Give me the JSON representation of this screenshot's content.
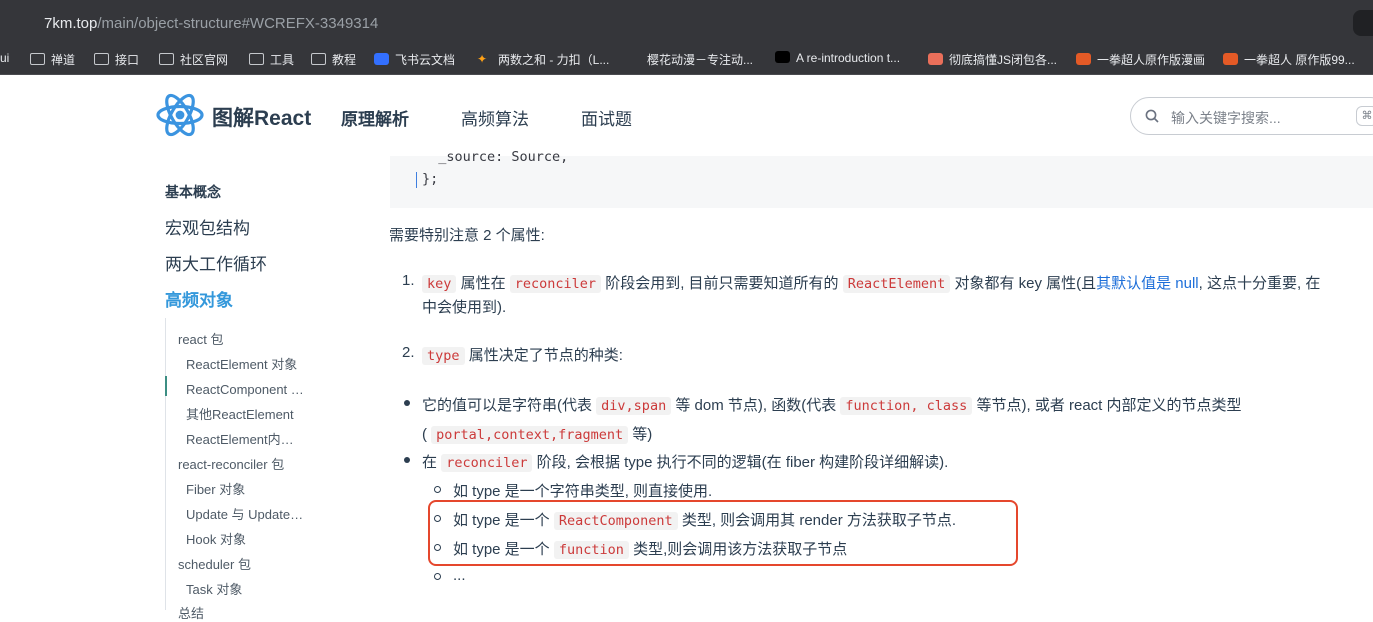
{
  "browser": {
    "url_host": "7km.top",
    "url_path": "/main/object-structure#WCREFX-3349314",
    "bookmarks": [
      {
        "label": "ui"
      },
      {
        "label": "禅道"
      },
      {
        "label": "接口"
      },
      {
        "label": "社区官网"
      },
      {
        "label": "工具"
      },
      {
        "label": "教程"
      },
      {
        "label": "飞书云文档"
      },
      {
        "label": "两数之和 - 力扣（L..."
      },
      {
        "label": "樱花动漫－专注动..."
      },
      {
        "label": "A re-introduction t..."
      },
      {
        "label": "彻底搞懂JS闭包各..."
      },
      {
        "label": "一拳超人原作版漫画"
      },
      {
        "label": "一拳超人 原作版99..."
      }
    ]
  },
  "header": {
    "title": "图解React",
    "nav": [
      "原理解析",
      "高频算法",
      "面试题"
    ],
    "search_placeholder": "输入关键字搜索...",
    "search_kbd": "⌘"
  },
  "sidebar": {
    "group_title": "基本概念",
    "items": [
      "宏观包结构",
      "两大工作循环",
      "高频对象"
    ],
    "subitems": {
      "react": "react 包",
      "re1": "ReactElement 对象",
      "re2": "ReactComponent 对象",
      "re3": "其他ReactElement",
      "re4": "ReactElement内存结构",
      "reconciler": "react-reconciler 包",
      "f1": "Fiber 对象",
      "f2": "Update 与 UpdateQueue 对象",
      "f3": "Hook 对象",
      "scheduler": "scheduler 包",
      "s1": "Task 对象",
      "summary": "总结"
    }
  },
  "main": {
    "code_line1": "  _source: Source,",
    "code_line2": "};",
    "intro": "需要特别注意 2 个属性:",
    "ol1": {
      "num": "1.",
      "c1": "key",
      "t1": "属性在",
      "c2": "reconciler",
      "t2": "阶段会用到, 目前只需要知道所有的",
      "c3": "ReactElement",
      "t3": "对象都有 key 属性(且",
      "link": "其默认值是 null",
      "t4": ", 这点十分重要, 在",
      "line2": "中会使用到)."
    },
    "ol2": {
      "num": "2.",
      "c1": "type",
      "t1": "属性决定了节点的种类:"
    },
    "ul1": {
      "t1": "它的值可以是字符串(代表",
      "c1": "div,span",
      "t2": "等 dom 节点), 函数(代表",
      "c2": "function, class",
      "t3": "等节点), 或者 react 内部定义的节点类型",
      "p1": "(",
      "c3": "portal,context,fragment",
      "p2": "等)"
    },
    "ul2": {
      "t1": "在",
      "c1": "reconciler",
      "t2": "阶段, 会根据 type 执行不同的逻辑(在 fiber 构建阶段详细解读)."
    },
    "sub1": "如 type 是一个字符串类型, 则直接使用.",
    "sub2": {
      "t1": "如 type 是一个",
      "c1": "ReactComponent",
      "t2": "类型, 则会调用其 render 方法获取子节点."
    },
    "sub3": {
      "t1": "如 type 是一个",
      "c1": "function",
      "t2": "类型,则会调用该方法获取子节点"
    },
    "sub4": "..."
  },
  "colors": {
    "accent": "#3498db",
    "inline_code": "#cc3a3a",
    "highlight_box": "#e5472d",
    "link": "#1e6fd9"
  }
}
